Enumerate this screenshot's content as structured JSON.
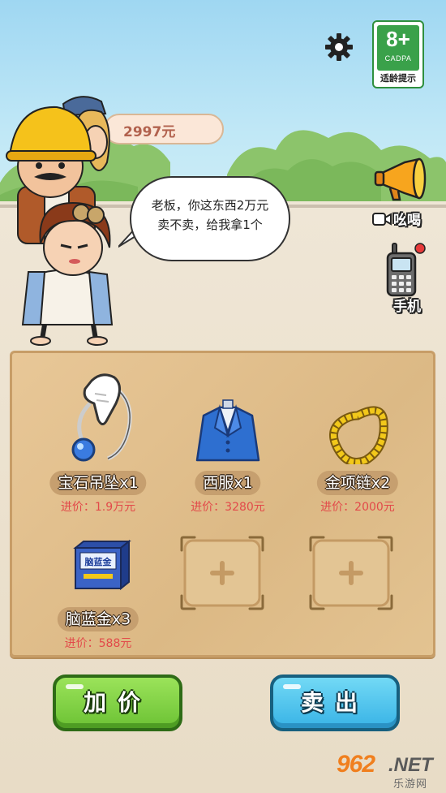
{
  "money": {
    "amount": "2997元"
  },
  "age_rating": {
    "rating": "8+",
    "org": "CADPA",
    "label": "适龄提示"
  },
  "dialog": {
    "line1": "老板，你这东西2万元",
    "line2": "卖不卖，给我拿1个"
  },
  "side_buttons": {
    "shout": "吆喝",
    "phone": "手机"
  },
  "items": [
    {
      "name": "宝石吊坠x1",
      "price": "进价：1.9万元",
      "icon": "gem-pendant-icon"
    },
    {
      "name": "西服x1",
      "price": "进价：3280元",
      "icon": "suit-icon"
    },
    {
      "name": "金项链x2",
      "price": "进价：2000元",
      "icon": "gold-necklace-icon"
    },
    {
      "name": "脑蓝金x3",
      "price": "进价：588元",
      "icon": "supplement-box-icon"
    }
  ],
  "product_box_text": "脑蓝金",
  "buttons": {
    "raise_price": "加价",
    "sell": "卖出"
  },
  "watermark": {
    "brand": "962",
    "suffix": ".NET",
    "site": "乐游网"
  },
  "colors": {
    "price_red": "#e24a4a",
    "raise_green": "#6cc234",
    "sell_blue": "#38b3e6",
    "money_text": "#b2624e"
  }
}
